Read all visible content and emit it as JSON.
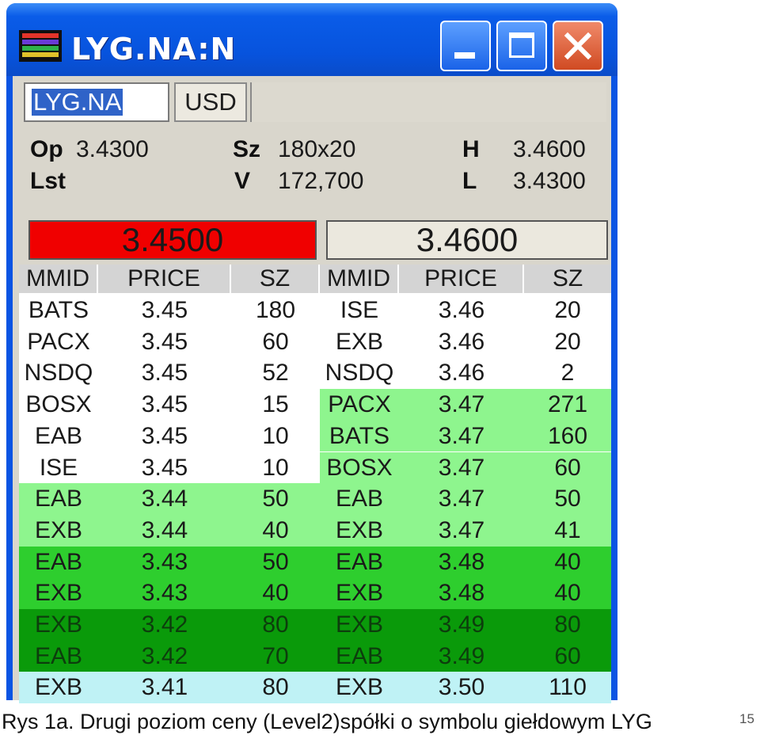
{
  "window": {
    "title": "LYG.NA:N"
  },
  "toolbar": {
    "symbol_value": "LYG.NA",
    "currency_label": "USD"
  },
  "quote": {
    "open_label": "Op",
    "open_value": "3.4300",
    "last_label": "Lst",
    "size_label": "Sz",
    "size_value": "180x20",
    "volume_label": "V",
    "volume_value": "172,700",
    "high_label": "H",
    "high_value": "3.4600",
    "low_label": "L",
    "low_value": "3.4300"
  },
  "inside": {
    "bid": "3.4500",
    "ask": "3.4600"
  },
  "columns": {
    "bid": [
      "MMID",
      "PRICE",
      "SZ"
    ],
    "ask": [
      "MMID",
      "PRICE",
      "SZ"
    ]
  },
  "colors": {
    "level_1": "#ffffff",
    "level_2": "#8ef58e",
    "level_3": "#2ece2e",
    "level_4": "#0a9a0a",
    "level_5": "#bff2f5",
    "bid_highlight": "#f00000"
  },
  "bids": [
    {
      "mmid": "BATS",
      "price": "3.45",
      "size": "180",
      "level": 1
    },
    {
      "mmid": "PACX",
      "price": "3.45",
      "size": "60",
      "level": 1
    },
    {
      "mmid": "NSDQ",
      "price": "3.45",
      "size": "52",
      "level": 1
    },
    {
      "mmid": "BOSX",
      "price": "3.45",
      "size": "15",
      "level": 1
    },
    {
      "mmid": "EAB",
      "price": "3.45",
      "size": "10",
      "level": 1
    },
    {
      "mmid": "ISE",
      "price": "3.45",
      "size": "10",
      "level": 1
    },
    {
      "mmid": "EAB",
      "price": "3.44",
      "size": "50",
      "level": 2
    },
    {
      "mmid": "EXB",
      "price": "3.44",
      "size": "40",
      "level": 2
    },
    {
      "mmid": "EAB",
      "price": "3.43",
      "size": "50",
      "level": 3
    },
    {
      "mmid": "EXB",
      "price": "3.43",
      "size": "40",
      "level": 3
    },
    {
      "mmid": "EXB",
      "price": "3.42",
      "size": "80",
      "level": 4
    },
    {
      "mmid": "EAB",
      "price": "3.42",
      "size": "70",
      "level": 4
    },
    {
      "mmid": "EXB",
      "price": "3.41",
      "size": "80",
      "level": 5
    }
  ],
  "asks": [
    {
      "mmid": "ISE",
      "price": "3.46",
      "size": "20",
      "level": 1
    },
    {
      "mmid": "EXB",
      "price": "3.46",
      "size": "20",
      "level": 1
    },
    {
      "mmid": "NSDQ",
      "price": "3.46",
      "size": "2",
      "level": 1
    },
    {
      "mmid": "PACX",
      "price": "3.47",
      "size": "271",
      "level": 2
    },
    {
      "mmid": "BATS",
      "price": "3.47",
      "size": "160",
      "level": 2
    },
    {
      "mmid": "BOSX",
      "price": "3.47",
      "size": "60",
      "level": 2
    },
    {
      "mmid": "EAB",
      "price": "3.47",
      "size": "50",
      "level": 2
    },
    {
      "mmid": "EXB",
      "price": "3.47",
      "size": "41",
      "level": 2
    },
    {
      "mmid": "EAB",
      "price": "3.48",
      "size": "40",
      "level": 3
    },
    {
      "mmid": "EXB",
      "price": "3.48",
      "size": "40",
      "level": 3
    },
    {
      "mmid": "EXB",
      "price": "3.49",
      "size": "80",
      "level": 4
    },
    {
      "mmid": "EAB",
      "price": "3.49",
      "size": "60",
      "level": 4
    },
    {
      "mmid": "EXB",
      "price": "3.50",
      "size": "110",
      "level": 5
    }
  ],
  "caption": "Rys 1a. Drugi poziom ceny (Level2)spółki o symbolu giełdowym LYG",
  "page_number": "15"
}
